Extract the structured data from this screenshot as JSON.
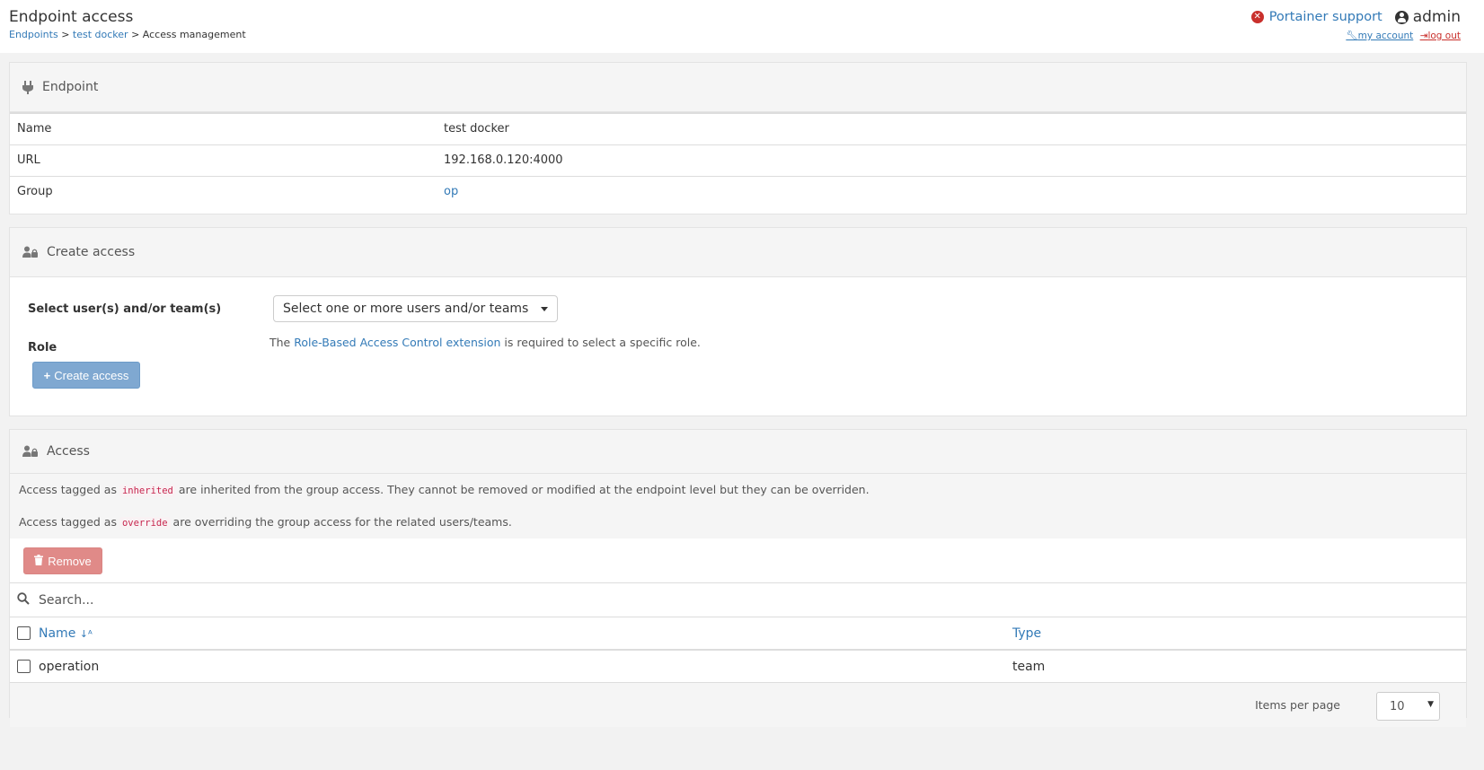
{
  "header": {
    "title": "Endpoint access",
    "breadcrumb": {
      "endpoints": "Endpoints",
      "sep1": " > ",
      "endpoint": "test docker",
      "sep2": " > ",
      "current": "Access management"
    },
    "support": "Portainer support",
    "username": "admin",
    "my_account": "my account",
    "logout": "log out"
  },
  "endpoint_widget": {
    "title": "Endpoint",
    "rows": [
      {
        "label": "Name",
        "value": "test docker"
      },
      {
        "label": "URL",
        "value": "192.168.0.120:4000"
      },
      {
        "label": "Group",
        "value": "op"
      }
    ]
  },
  "create_access": {
    "title": "Create access",
    "select_label": "Select user(s) and/or team(s)",
    "select_placeholder": "Select one or more users and/or teams",
    "role_label": "Role",
    "role_note_prefix": "The ",
    "role_note_link": "Role-Based Access Control extension",
    "role_note_suffix": " is required to select a specific role.",
    "button": "Create access"
  },
  "access": {
    "title": "Access",
    "info1_prefix": "Access tagged as",
    "info1_tag": "inherited",
    "info1_suffix": "are inherited from the group access. They cannot be removed or modified at the endpoint level but they can be overriden.",
    "info2_prefix": "Access tagged as",
    "info2_tag": "override",
    "info2_suffix": "are overriding the group access for the related users/teams.",
    "remove_button": "Remove",
    "search_placeholder": "Search...",
    "columns": {
      "name": "Name",
      "type": "Type"
    },
    "rows": [
      {
        "name": "operation",
        "type": "team"
      }
    ],
    "items_per_page_label": "Items per page",
    "items_per_page_value": "10"
  },
  "colors": {
    "link": "#337ab7",
    "danger": "#c9302c",
    "primary_disabled": "#7fa8d1",
    "remove_disabled": "#e08a88"
  }
}
